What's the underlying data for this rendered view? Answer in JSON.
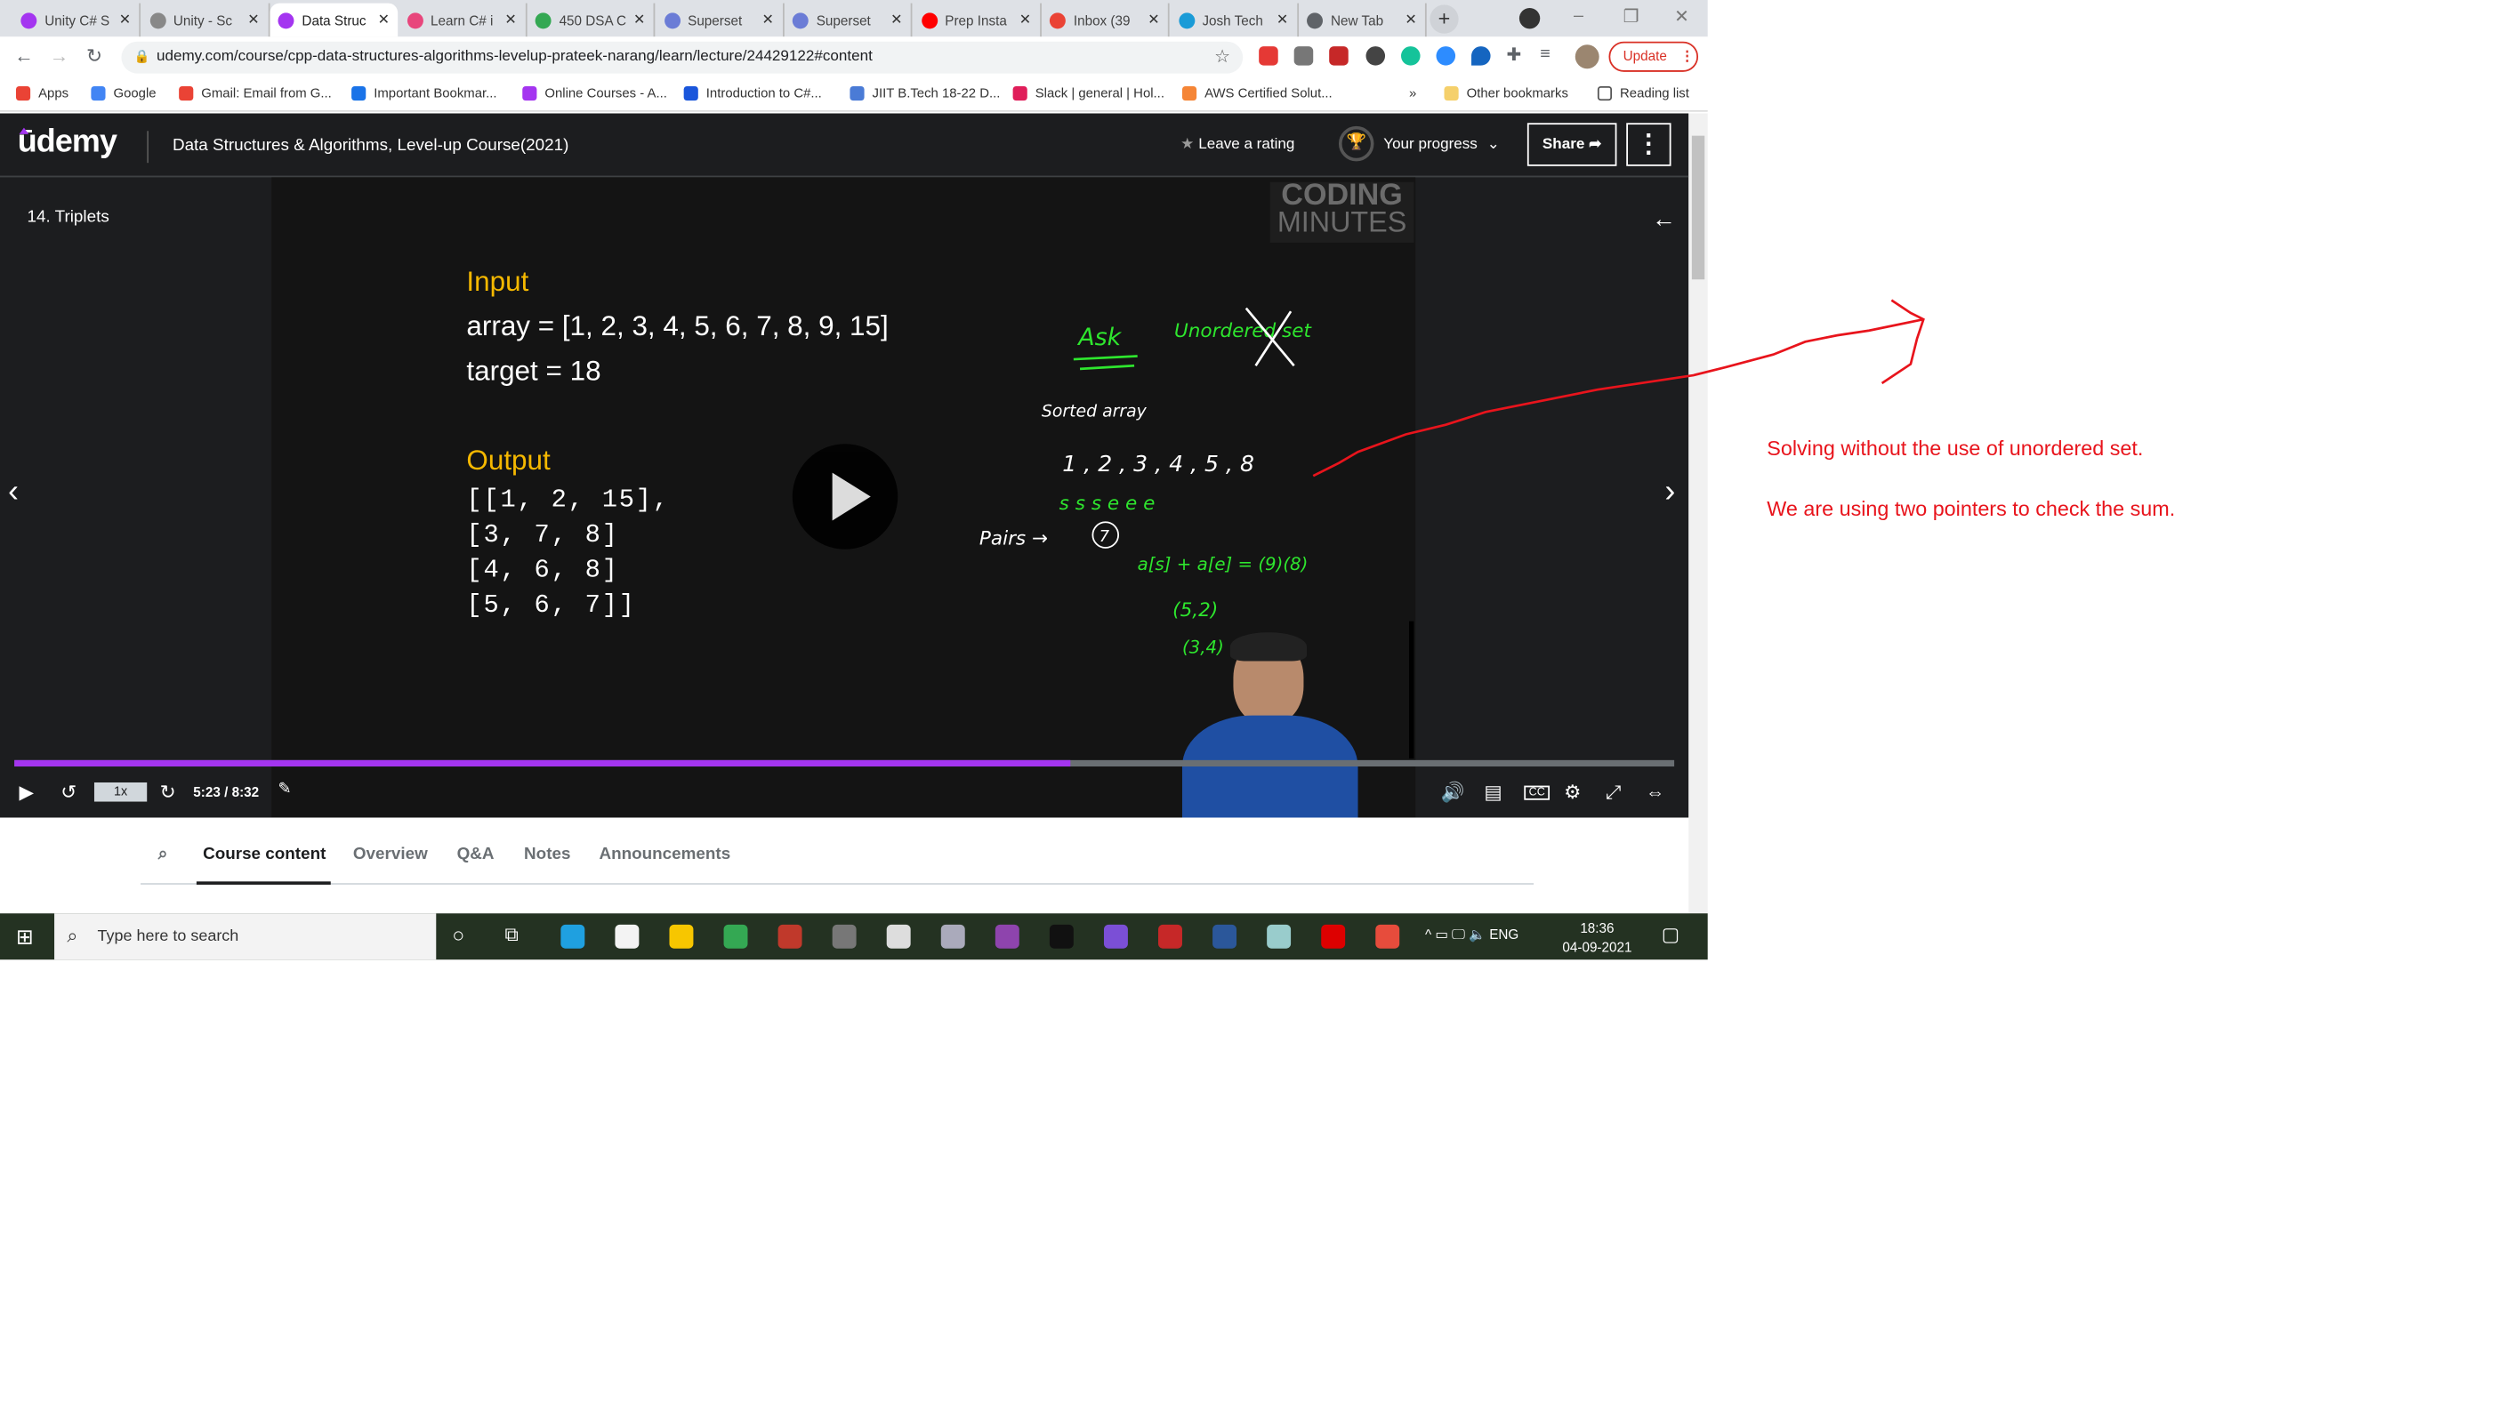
{
  "browser": {
    "tabs": [
      {
        "title": "Unity C# S",
        "icon": "udemy-icon",
        "color": "#a435f0"
      },
      {
        "title": "Unity - Sc",
        "icon": "unity-icon",
        "color": "#888888"
      },
      {
        "title": "Data Struc",
        "icon": "udemy-icon",
        "color": "#a435f0",
        "active": true
      },
      {
        "title": "Learn C# i",
        "icon": "learn-icon",
        "color": "#e8467c"
      },
      {
        "title": "450 DSA C",
        "icon": "sheet-icon",
        "color": "#34a853"
      },
      {
        "title": "Superset",
        "icon": "superset-icon",
        "color": "#6b7cd6"
      },
      {
        "title": "Superset",
        "icon": "superset-icon",
        "color": "#6b7cd6"
      },
      {
        "title": "Prep Insta",
        "icon": "youtube-icon",
        "color": "#ff0000"
      },
      {
        "title": "Inbox (39",
        "icon": "gmail-icon",
        "color": "#ea4335"
      },
      {
        "title": "Josh Tech",
        "icon": "josh-icon",
        "color": "#1a9bd7"
      },
      {
        "title": "New Tab",
        "icon": "chrome-icon",
        "color": "#5f6368"
      }
    ],
    "url": "udemy.com/course/cpp-data-structures-algorithms-levelup-prateek-narang/learn/lecture/24429122#content",
    "update_label": "Update",
    "bookmarks": [
      {
        "label": "Apps",
        "color": "#ea4335"
      },
      {
        "label": "Google",
        "color": "#4285f4"
      },
      {
        "label": "Gmail: Email from G...",
        "color": "#ea4335"
      },
      {
        "label": "Important Bookmar...",
        "color": "#1a73e8"
      },
      {
        "label": "Online Courses - A...",
        "color": "#a435f0"
      },
      {
        "label": "Introduction to C#...",
        "color": "#1a56db"
      },
      {
        "label": "JIIT B.Tech 18-22 D...",
        "color": "#4a7bd6"
      },
      {
        "label": "Slack | general | Hol...",
        "color": "#e01e5a"
      },
      {
        "label": "AWS Certified Solut...",
        "color": "#f58536"
      }
    ],
    "bookmarks_overflow": "»",
    "other_bookmarks": "Other bookmarks",
    "reading_list": "Reading list"
  },
  "udemy": {
    "logo": "ūdemy",
    "course_title": "Data Structures & Algorithms, Level-up Course(2021)",
    "leave_rating": "Leave a rating",
    "your_progress": "Your progress",
    "share": "Share",
    "accent": "#a435f0"
  },
  "video": {
    "lecture": "14. Triplets",
    "watermark_top": "CODING",
    "watermark_bottom": "MINUTES",
    "slide": {
      "input_heading": "Input",
      "array_line": "array = [1, 2, 3, 4, 5, 6, 7, 8, 9, 15]",
      "target_line": "target = 18",
      "output_heading": "Output",
      "output_lines": [
        "[[1, 2, 15],",
        "[3, 7, 8]",
        "[4, 6, 8]",
        "[5, 6, 7]]"
      ]
    },
    "handwriting": {
      "ask": "Ask",
      "unordered": "Unordered set",
      "sorted": "Sorted array",
      "numbers": "1 , 2 , 3 , 4 , 5 , 8",
      "pointers": "s  s  s    e  e  e",
      "pairs": "Pairs →",
      "pairs_target": "7",
      "equation": "a[s] + a[e] = (9)(8)",
      "pair1": "(5,2)",
      "pair2": "(3,4)"
    },
    "progress_fraction": 0.636,
    "time": "5:23 / 8:32",
    "speed": "1x",
    "cc": "CC"
  },
  "content_tabs": [
    "Course content",
    "Overview",
    "Q&A",
    "Notes",
    "Announcements"
  ],
  "taskbar": {
    "search_placeholder": "Type here to search",
    "lang": "ENG",
    "time": "18:36",
    "date": "04-09-2021"
  },
  "annotations": {
    "note1": "Solving without the use of unordered set.",
    "note2": "We are using two pointers to check the sum.",
    "color": "#e8141c"
  }
}
